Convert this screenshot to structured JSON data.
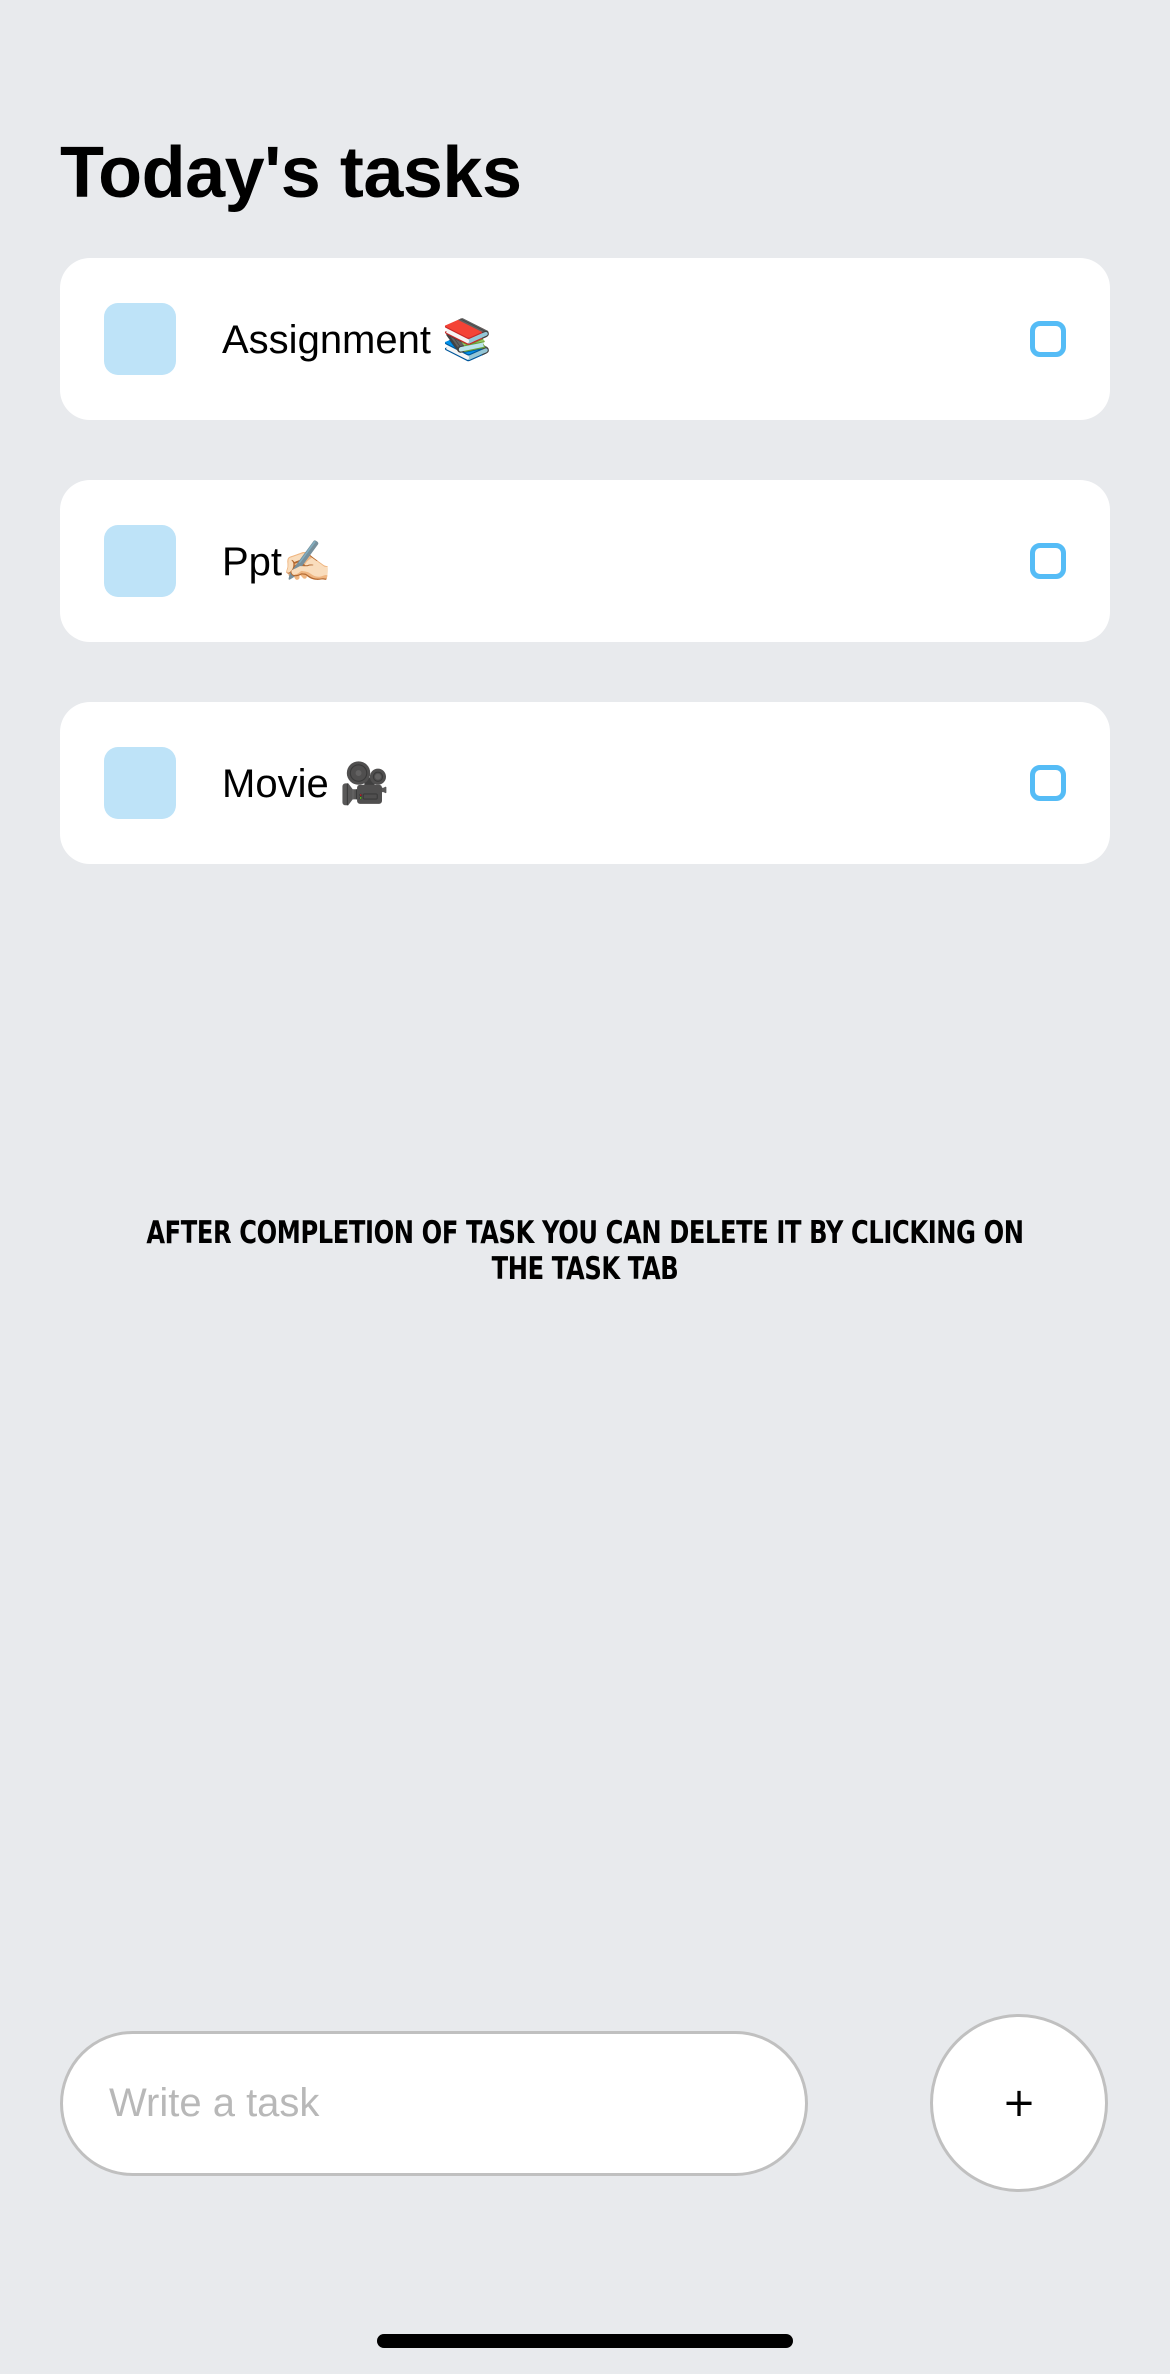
{
  "header": {
    "title": "Today's tasks"
  },
  "tasks": [
    {
      "label": "Assignment 📚"
    },
    {
      "label": "Ppt✍🏻"
    },
    {
      "label": "Movie 🎥"
    }
  ],
  "hint": "AFTER COMPLETION OF TASK YOU CAN DELETE IT BY CLICKING ON THE TASK TAB",
  "composer": {
    "placeholder": "Write a task",
    "value": "",
    "add_label": "+"
  },
  "colors": {
    "background": "#E8EAED",
    "task_square": "#BEE3F8",
    "task_circle": "#55BCF6",
    "card": "#FFFFFF"
  },
  "icons": {
    "task_square": "square-icon",
    "task_status": "circle-outline-icon"
  }
}
